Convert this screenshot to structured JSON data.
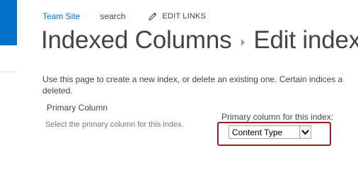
{
  "topnav": {
    "site_link": "Team Site",
    "search_link": "search",
    "edit_links": "EDIT LINKS"
  },
  "breadcrumb": {
    "parent": "Indexed Columns",
    "current": "Edit index"
  },
  "description": "Use this page to create a new index, or delete an existing one. Certain indices a deleted.",
  "primary_section": {
    "heading": "Primary Column",
    "description": "Select the primary column for this index.",
    "field_label": "Primary column for this index:",
    "selected_value": "Content Type"
  },
  "colors": {
    "accent": "#0072c6",
    "highlight_border": "#a01c1c",
    "text": "#444444"
  },
  "icons": {
    "edit": "pencil-icon",
    "dropdown": "chevron-down-icon"
  }
}
